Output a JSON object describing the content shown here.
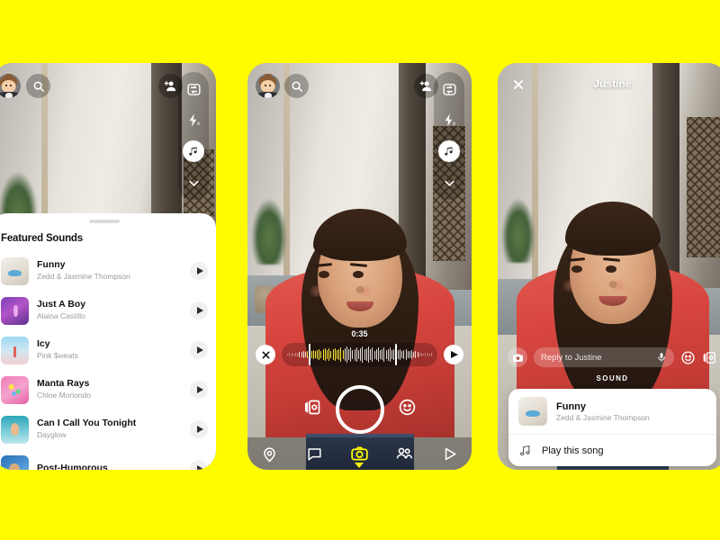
{
  "background_color": "#FFFC00",
  "phone1": {
    "name": "sound-picker-screen",
    "topbar": {
      "avatar": "bitmoji-avatar",
      "search_icon": "search-icon",
      "add_friend_icon": "add-friend-icon"
    },
    "rail": [
      {
        "icon": "flip-camera-icon"
      },
      {
        "icon": "flash-off-icon"
      },
      {
        "icon": "music-note-icon",
        "active": true
      },
      {
        "icon": "chevron-down-icon"
      }
    ],
    "sheet": {
      "title": "Featured Sounds",
      "sounds": [
        {
          "title": "Funny",
          "artist": "Zedd & Jasmine Thompson",
          "art": "art-a"
        },
        {
          "title": "Just A Boy",
          "artist": "Alaina Castillo",
          "art": "art-b"
        },
        {
          "title": "Icy",
          "artist": "Pink $weats",
          "art": "art-c"
        },
        {
          "title": "Manta Rays",
          "artist": "Chloe Moriondo",
          "art": "art-d"
        },
        {
          "title": "Can I Call You Tonight",
          "artist": "Dayglow",
          "art": "art-e"
        },
        {
          "title": "Post-Humorous",
          "artist": "",
          "art": "art-f"
        }
      ],
      "play_icon": "play-icon"
    }
  },
  "phone2": {
    "name": "sound-trim-camera-screen",
    "topbar": {
      "avatar": "bitmoji-avatar",
      "search_icon": "search-icon",
      "add_friend_icon": "add-friend-icon"
    },
    "rail": [
      {
        "icon": "flip-camera-icon"
      },
      {
        "icon": "flash-off-icon"
      },
      {
        "icon": "music-note-icon",
        "active": true
      },
      {
        "icon": "chevron-down-icon"
      }
    ],
    "editor": {
      "timer": "0:35",
      "close_icon": "close-icon",
      "play_icon": "play-icon",
      "waveform_accent": "#FFE93B"
    },
    "capture": {
      "shutter": "shutter-button",
      "left_icon": "lens-carousel-icon",
      "right_icon": "smiley-lens-icon"
    },
    "navbar": [
      {
        "icon": "map-pin-icon",
        "name": "nav-map"
      },
      {
        "icon": "chat-bubble-icon",
        "name": "nav-chat"
      },
      {
        "icon": "camera-icon",
        "name": "nav-camera",
        "active": true
      },
      {
        "icon": "friends-icon",
        "name": "nav-friends"
      },
      {
        "icon": "play-triangle-icon",
        "name": "nav-spotlight"
      }
    ],
    "active_nav_color": "#FFFC00"
  },
  "phone3": {
    "name": "snap-viewer-screen",
    "header": {
      "close_icon": "close-icon",
      "title": "Justine"
    },
    "reply": {
      "camera_icon": "camera-icon",
      "placeholder": "Reply to Justine",
      "mic_icon": "microphone-icon",
      "emoji_icon": "smiley-icon",
      "cards_icon": "lens-carousel-icon"
    },
    "sound_label": "SOUND",
    "card": {
      "title": "Funny",
      "artist": "Zedd & Jasmine Thompson",
      "art": "art-a",
      "action_icon": "music-note-icon",
      "action_label": "Play this song"
    }
  }
}
